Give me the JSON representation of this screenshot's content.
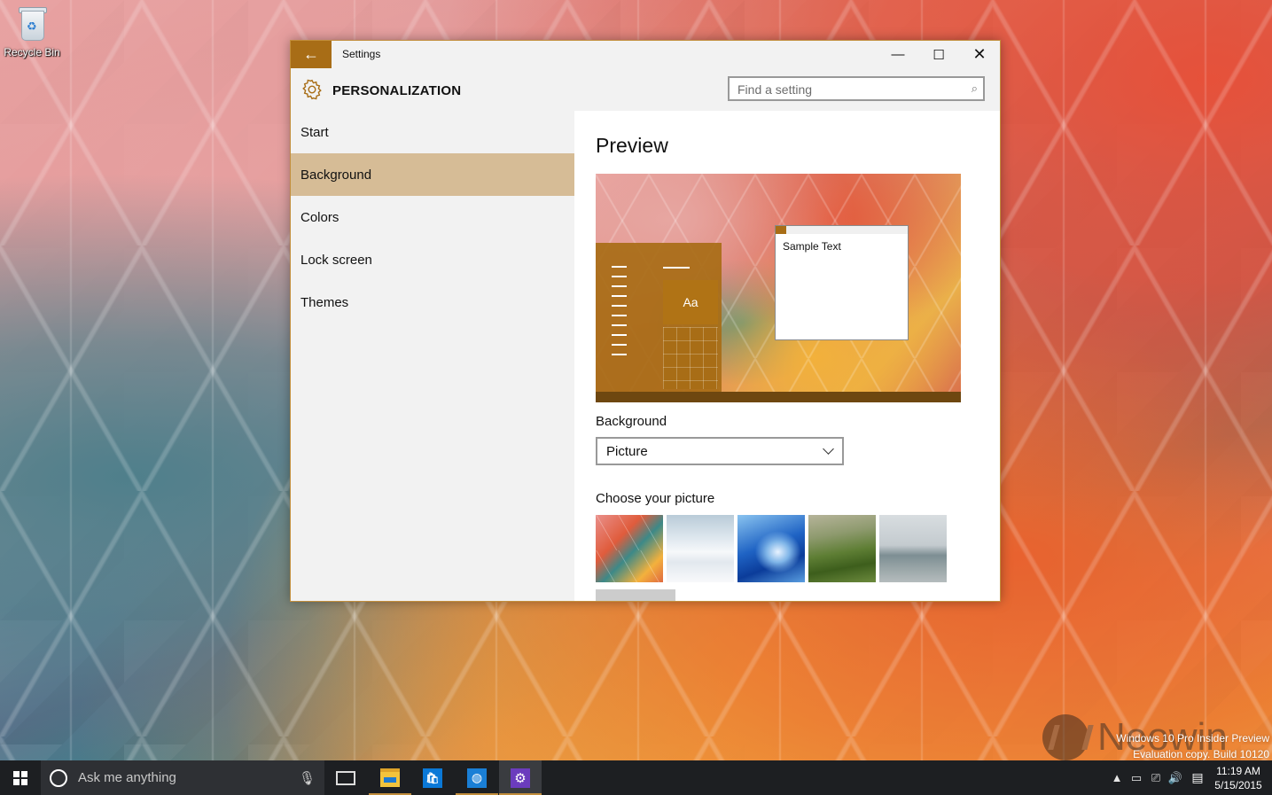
{
  "desktop": {
    "recycle_bin_label": "Recycle Bin",
    "watermark_line1": "Windows 10 Pro Insider Preview",
    "watermark_line2": "Evaluation copy. Build 10120",
    "brand_watermark": "Neowin"
  },
  "window": {
    "title": "Settings",
    "back_icon": "back-arrow-icon",
    "minimize_glyph": "—",
    "maximize_glyph": "☐",
    "close_glyph": "✕",
    "accent_color": "#a86d16"
  },
  "header": {
    "title": "PERSONALIZATION",
    "icon": "gear-icon",
    "search_placeholder": "Find a setting"
  },
  "sidebar": {
    "items": [
      {
        "label": "Start"
      },
      {
        "label": "Background"
      },
      {
        "label": "Colors"
      },
      {
        "label": "Lock screen"
      },
      {
        "label": "Themes"
      }
    ],
    "active": "Background",
    "active_color": "#d6bc96"
  },
  "main": {
    "preview_heading": "Preview",
    "preview_tile_text": "Aa",
    "preview_sample_text": "Sample Text",
    "background_label": "Background",
    "background_value": "Picture",
    "choose_picture_label": "Choose your picture",
    "pictures": [
      "geometric-wallpaper",
      "snowy-mountains",
      "blue-abstract",
      "green-hills",
      "coastal-road"
    ]
  },
  "taskbar": {
    "search_placeholder": "Ask me anything",
    "time": "11:19 AM",
    "date": "5/15/2015",
    "apps": [
      "task-view",
      "file-explorer",
      "store",
      "browser",
      "settings"
    ]
  }
}
